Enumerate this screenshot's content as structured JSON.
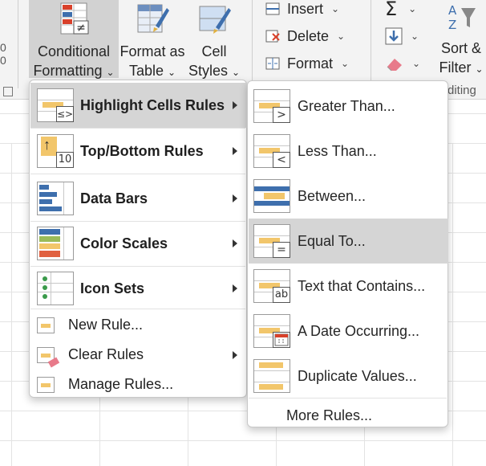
{
  "ribbon": {
    "conditional_formatting": {
      "line1": "Conditional",
      "line2": "Formatting"
    },
    "format_as_table": {
      "line1": "Format as",
      "line2": "Table"
    },
    "cell_styles": {
      "line1": "Cell",
      "line2": "Styles"
    },
    "insert_label": "Insert",
    "delete_label": "Delete",
    "format_label": "Format",
    "sort_filter": {
      "line1": "Sort &",
      "line2": "Filter"
    },
    "editing_group_partial": "diting",
    "left_edge_partial_1": "0",
    "left_edge_partial_2": "0"
  },
  "main_menu": {
    "items": [
      {
        "label": "Highlight Cells Rules",
        "mnemonic": "H",
        "has_submenu": true,
        "highlighted": true,
        "icon": "highlight-cells-icon"
      },
      {
        "label": "Top/Bottom Rules",
        "mnemonic": "T",
        "has_submenu": true,
        "highlighted": false,
        "icon": "top-bottom-icon",
        "icon_badge": "10"
      },
      {
        "label": "Data Bars",
        "mnemonic": "D",
        "has_submenu": true,
        "highlighted": false,
        "icon": "data-bars-icon"
      },
      {
        "label": "Color Scales",
        "mnemonic": "S",
        "has_submenu": true,
        "highlighted": false,
        "icon": "color-scales-icon"
      },
      {
        "label": "Icon Sets",
        "mnemonic": "I",
        "has_submenu": true,
        "highlighted": false,
        "icon": "icon-sets-icon"
      }
    ],
    "commands": [
      {
        "label": "New Rule...",
        "mnemonic": "N",
        "has_submenu": false,
        "icon": "new-rule-icon"
      },
      {
        "label": "Clear Rules",
        "mnemonic": "C",
        "has_submenu": true,
        "icon": "clear-rules-icon"
      },
      {
        "label": "Manage Rules...",
        "mnemonic": "R",
        "has_submenu": false,
        "icon": "manage-rules-icon"
      }
    ]
  },
  "sub_menu": {
    "items": [
      {
        "label": "Greater Than...",
        "mnemonic": "G",
        "badge": ">",
        "highlighted": false,
        "icon": "greater-than-icon"
      },
      {
        "label": "Less Than...",
        "mnemonic": "L",
        "badge": "<",
        "highlighted": false,
        "icon": "less-than-icon"
      },
      {
        "label": "Between...",
        "mnemonic": "B",
        "badge": "",
        "highlighted": false,
        "icon": "between-icon"
      },
      {
        "label": "Equal To...",
        "mnemonic": "E",
        "badge": "=",
        "highlighted": true,
        "icon": "equal-to-icon"
      },
      {
        "label": "Text that Contains...",
        "mnemonic": "T",
        "badge": "ab",
        "highlighted": false,
        "icon": "text-contains-icon"
      },
      {
        "label": "A Date Occurring...",
        "mnemonic": "A",
        "badge": "",
        "highlighted": false,
        "icon": "date-occurring-icon"
      },
      {
        "label": "Duplicate Values...",
        "mnemonic": "D",
        "badge": "",
        "highlighted": false,
        "icon": "duplicate-values-icon"
      }
    ],
    "more_rules": {
      "label": "More Rules...",
      "mnemonic": "M"
    }
  },
  "colors": {
    "highlight_yellow": "#f2c66b",
    "data_bar_blue": "#3e6fad",
    "menu_hover": "#d5d5d5",
    "ribbon_bg": "#f3f3f3"
  }
}
